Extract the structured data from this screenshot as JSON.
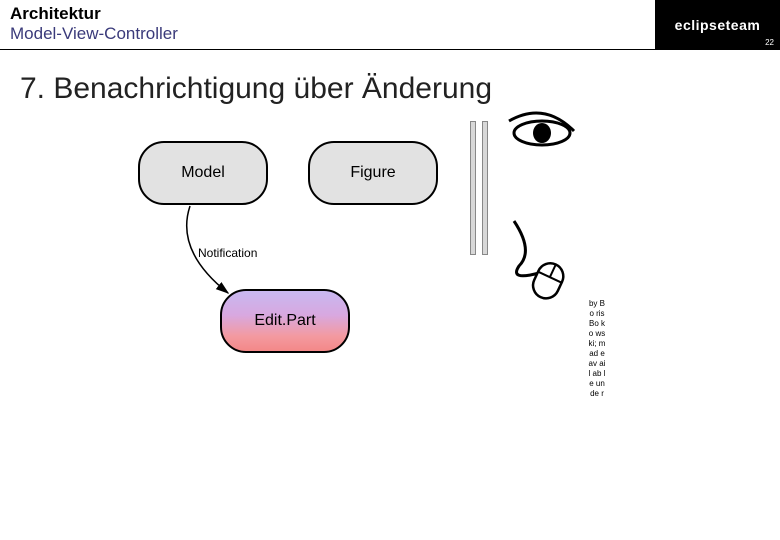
{
  "header": {
    "title": "Architektur",
    "subtitle": "Model-View-Controller",
    "logo_text": "eclipseteam",
    "page_number": "22"
  },
  "slide": {
    "heading": "7. Benachrichtigung über Änderung"
  },
  "diagram": {
    "nodes": {
      "model": "Model",
      "figure": "Figure",
      "editpart": "Edit.Part"
    },
    "labels": {
      "notification": "Notification"
    }
  },
  "credit": "by Bo ris Bo ko ws ki; m ad e av ail ab le un de r"
}
